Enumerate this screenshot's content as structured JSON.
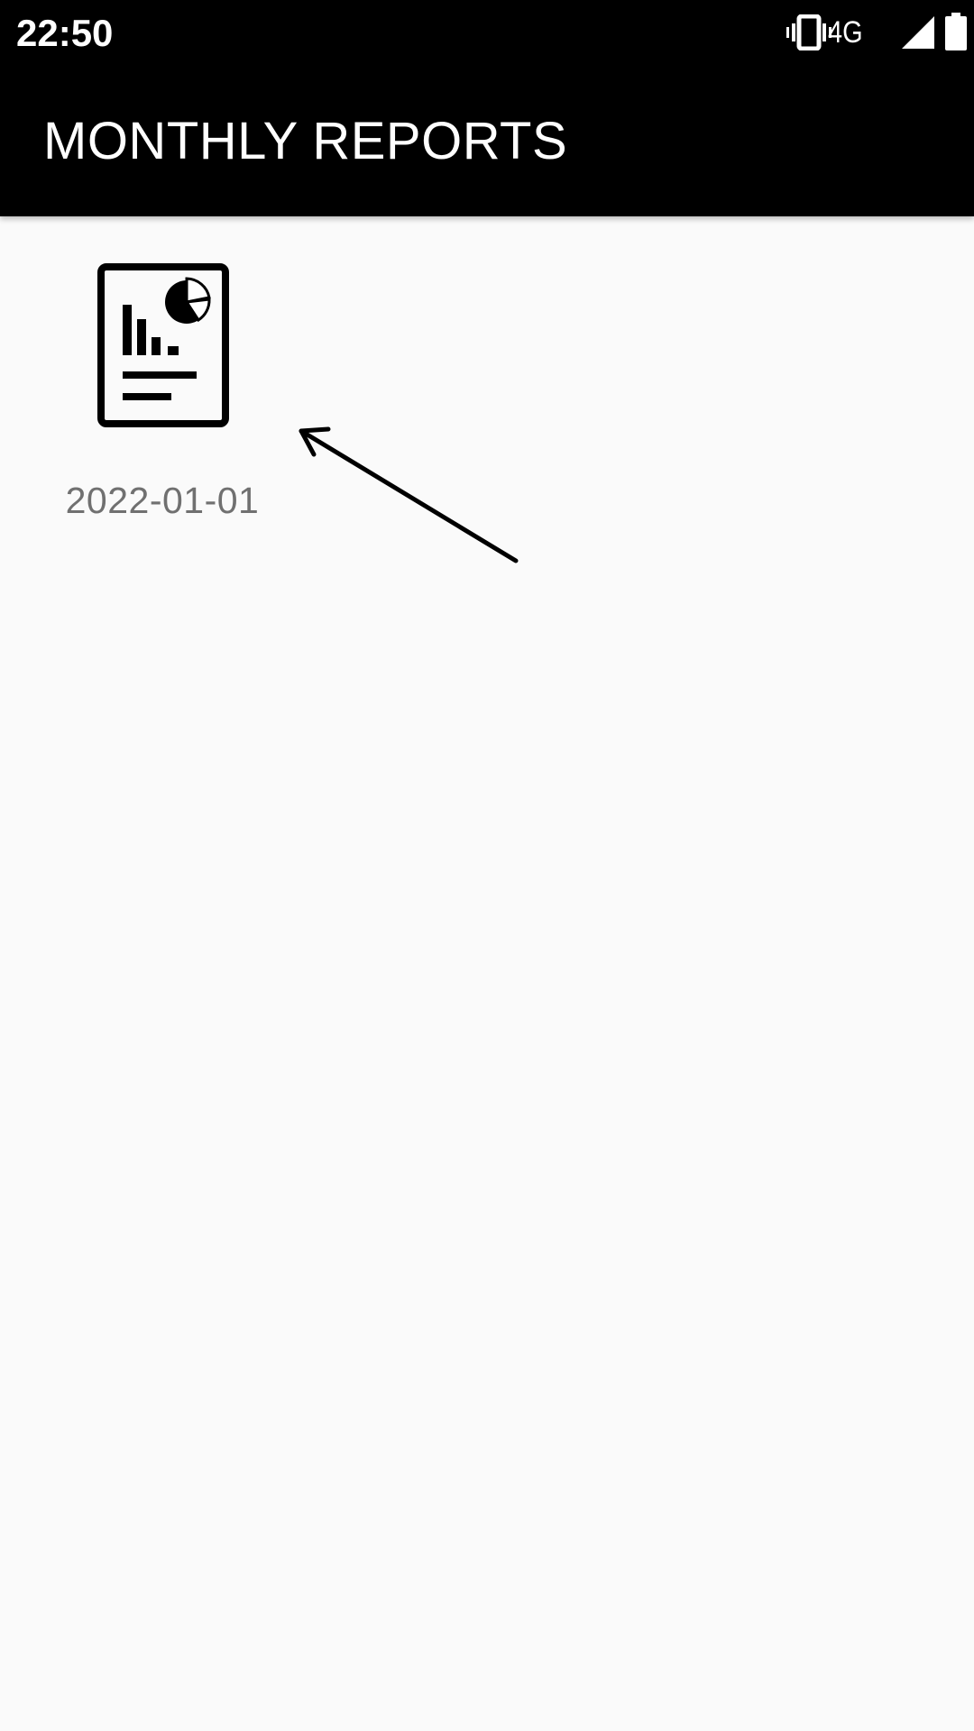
{
  "status_bar": {
    "time": "22:50",
    "network": "4G",
    "icons": [
      "vibrate-icon",
      "signal-icon",
      "battery-icon"
    ]
  },
  "app_bar": {
    "title": "MONTHLY REPORTS"
  },
  "reports": [
    {
      "label": "2022-01-01",
      "icon": "report-document-icon"
    }
  ],
  "colors": {
    "app_bar_bg": "#000000",
    "status_bar_bg": "#000000",
    "background": "#fafafa",
    "label_text": "#707070",
    "title_text": "#ffffff"
  }
}
